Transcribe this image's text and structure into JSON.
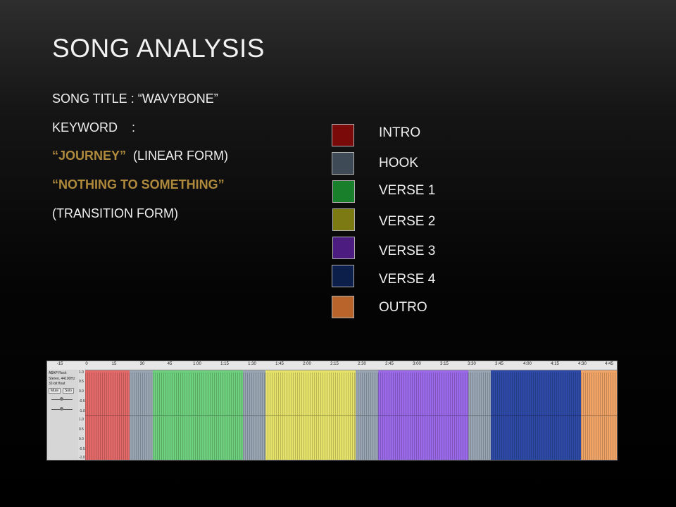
{
  "slide": {
    "title": "SONG ANALYSIS",
    "lines": {
      "song_title": "SONG TITLE : “WAVYBONE”",
      "keyword": "KEYWORD    :",
      "journey_quote": "“JOURNEY”",
      "journey_rest": "  (LINEAR FORM)",
      "nothing_quote": "“NOTHING TO SOMETHING”",
      "transition": "(TRANSITION FORM)"
    }
  },
  "legend": [
    {
      "label": "INTRO",
      "color": "#7a0a0a"
    },
    {
      "label": "HOOK",
      "color": "#3f4a57"
    },
    {
      "label": "VERSE 1",
      "color": "#1a7f2a"
    },
    {
      "label": "VERSE 2",
      "color": "#7c7a12"
    },
    {
      "label": "VERSE 3",
      "color": "#4c1c80"
    },
    {
      "label": "VERSE 4",
      "color": "#0c1f4a"
    },
    {
      "label": "OUTRO",
      "color": "#b8642a"
    }
  ],
  "audio_track": {
    "ruler_ticks": [
      "-15",
      "0",
      "15",
      "30",
      "45",
      "1:00",
      "1:15",
      "1:30",
      "1:45",
      "2:00",
      "2:15",
      "2:30",
      "2:45",
      "3:00",
      "3:15",
      "3:30",
      "3:45",
      "4:00",
      "4:15",
      "4:30",
      "4:45"
    ],
    "track_name": "A$AP Rock",
    "track_info_1": "Stereo, 44100Hz",
    "track_info_2": "32-bit float",
    "mute_label": "Mute",
    "solo_label": "Solo",
    "scale_labels": [
      "1.0",
      "0.5",
      "0.0",
      "-0.5",
      "-1.0",
      "1.0",
      "0.5",
      "0.0",
      "-0.5",
      "-1.0"
    ],
    "segments": [
      {
        "section": "INTRO",
        "color": "#e46a6a"
      },
      {
        "section": "HOOK",
        "color": "#9aa6b4"
      },
      {
        "section": "VERSE 1",
        "color": "#6fd07e"
      },
      {
        "section": "HOOK",
        "color": "#9aa6b4"
      },
      {
        "section": "VERSE 2",
        "color": "#e6e26a"
      },
      {
        "section": "HOOK",
        "color": "#9aa6b4"
      },
      {
        "section": "VERSE 3",
        "color": "#9a6ae8"
      },
      {
        "section": "HOOK",
        "color": "#9aa6b4"
      },
      {
        "section": "VERSE 4",
        "color": "#2e4aa6"
      },
      {
        "section": "OUTRO",
        "color": "#f0a468"
      }
    ]
  }
}
